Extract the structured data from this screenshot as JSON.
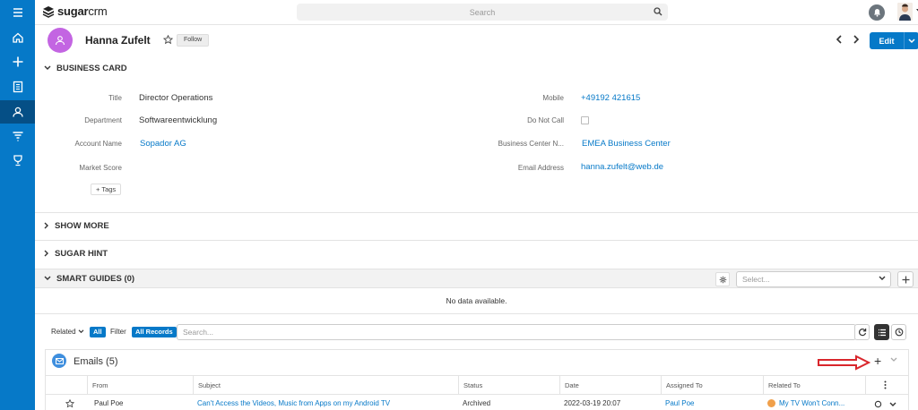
{
  "app": {
    "logo_bold": "sugar",
    "logo_light": "crm",
    "search_placeholder": "Search"
  },
  "record": {
    "name": "Hanna Zufelt",
    "follow_label": "Follow",
    "edit_label": "Edit"
  },
  "business_card": {
    "title": "BUSINESS CARD",
    "fields_left": [
      {
        "label": "Title",
        "value": "Director Operations",
        "link": false
      },
      {
        "label": "Department",
        "value": "Softwareentwicklung",
        "link": false
      },
      {
        "label": "Account Name",
        "value": "Sopador AG",
        "link": true
      },
      {
        "label": "Market Score",
        "value": "",
        "link": false
      }
    ],
    "fields_right": [
      {
        "label": "Mobile",
        "value": "+49192 421615",
        "link": true
      },
      {
        "label": "Do Not Call",
        "value": "",
        "link": false
      },
      {
        "label": "Business Center N...",
        "value": "EMEA Business Center",
        "link": true
      },
      {
        "label": "Email Address",
        "value": "hanna.zufelt@web.de",
        "link": true
      }
    ],
    "tags_label": "+ Tags"
  },
  "sections": {
    "show_more": "SHOW MORE",
    "sugar_hint": "SUGAR HINT",
    "smart_guides": "SMART GUIDES (0)"
  },
  "smart_guides": {
    "select_placeholder": "Select...",
    "no_data": "No data available."
  },
  "subpanel_toolbar": {
    "related_label": "Related",
    "related_pill": "All",
    "filter_label": "Filter",
    "filter_pill": "All Records",
    "search_placeholder": "Search..."
  },
  "emails": {
    "title": "Emails (5)",
    "columns": [
      "From",
      "Subject",
      "Status",
      "Date",
      "Assigned To",
      "Related To"
    ],
    "first_row": {
      "from": "Paul Poe",
      "subject": "Can't Access the Videos, Music from Apps on my Android TV",
      "status": "Archived",
      "date": "2022-03-19 20:07",
      "assigned_to": "Paul Poe",
      "related_to": "My TV Won't Conn..."
    }
  },
  "colors": {
    "brand": "#0679c8",
    "sidebar_active": "#054f86",
    "avatar": "#c365e2",
    "arrow": "#d9262c"
  }
}
